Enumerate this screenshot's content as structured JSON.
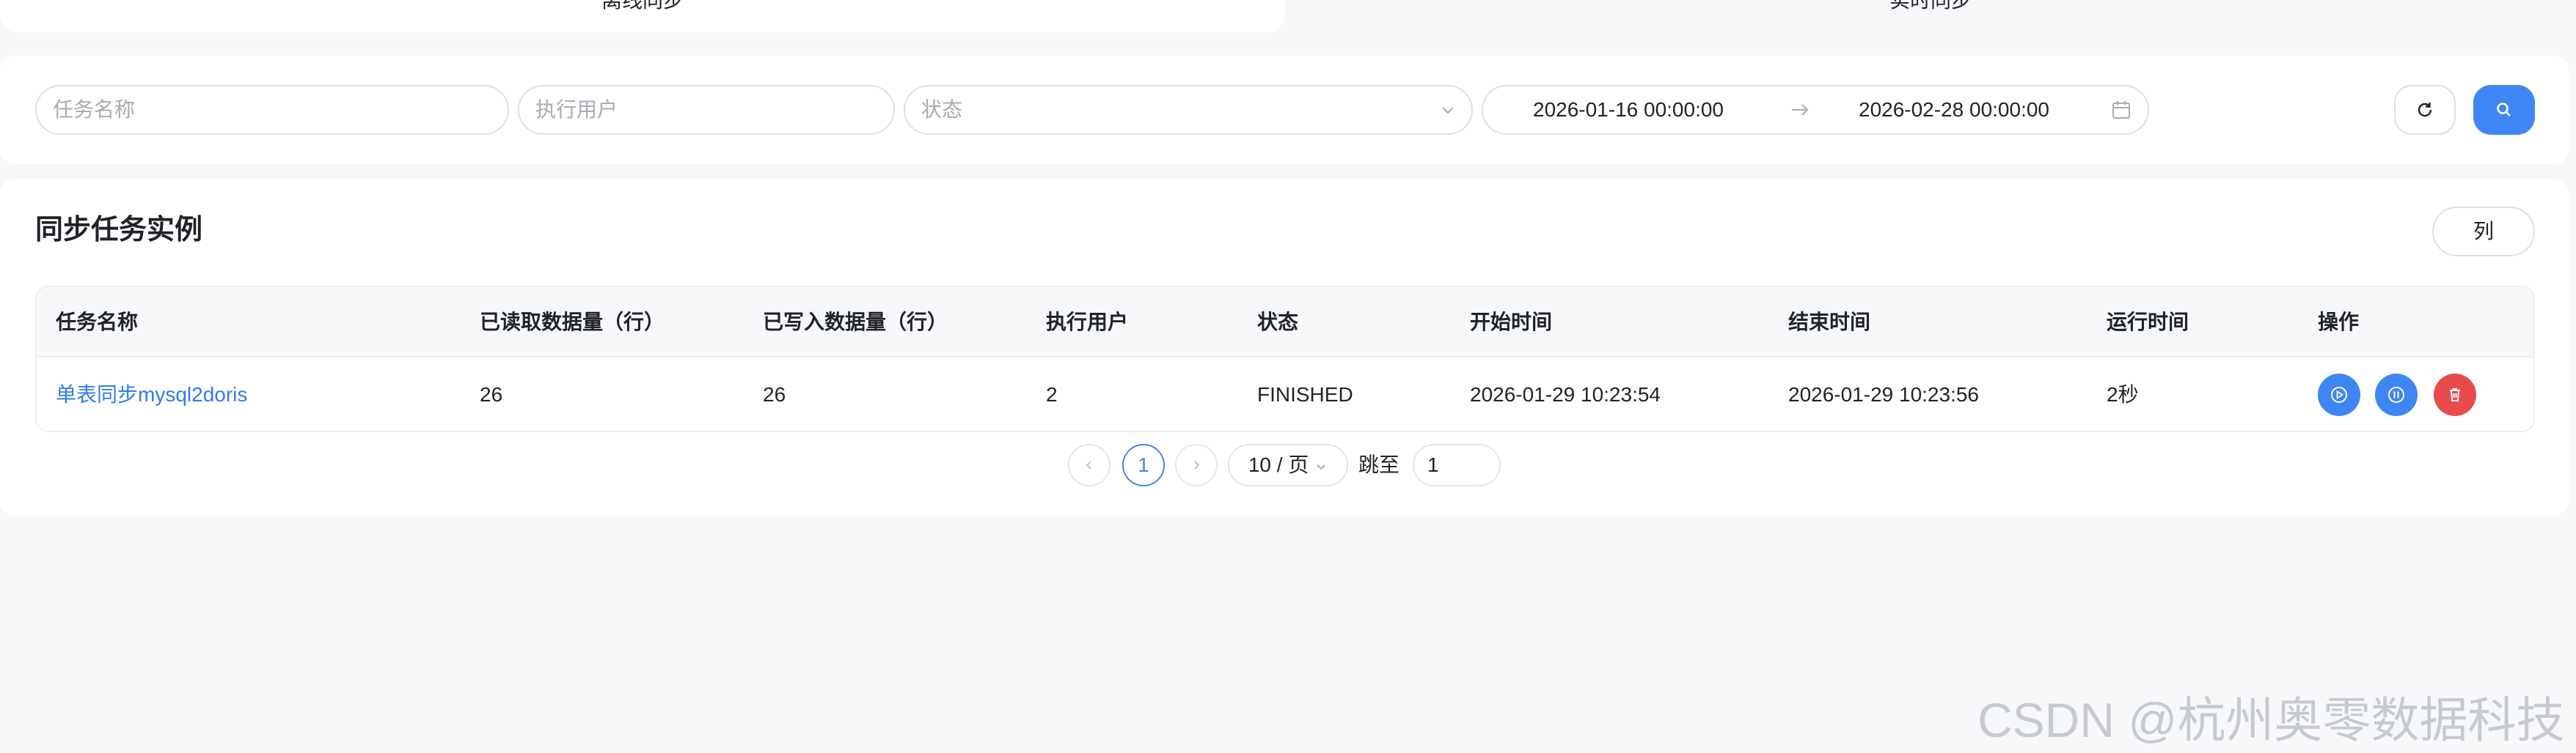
{
  "tabs": [
    {
      "label": "离线同步",
      "active": true
    },
    {
      "label": "实时同步",
      "active": false
    }
  ],
  "filters": {
    "task_name_placeholder": "任务名称",
    "user_placeholder": "执行用户",
    "status_placeholder": "状态",
    "date_start": "2026-01-16 00:00:00",
    "date_end": "2026-02-28 00:00:00"
  },
  "card": {
    "title": "同步任务实例",
    "columns_button": "列"
  },
  "table": {
    "headers": [
      "任务名称",
      "已读取数据量（行）",
      "已写入数据量（行）",
      "执行用户",
      "状态",
      "开始时间",
      "结束时间",
      "运行时间",
      "操作"
    ],
    "rows": [
      {
        "task_name": "单表同步mysql2doris",
        "read_rows": "26",
        "written_rows": "26",
        "user": "2",
        "status": "FINISHED",
        "start_time": "2026-01-29 10:23:54",
        "end_time": "2026-01-29 10:23:56",
        "duration": "2秒"
      }
    ]
  },
  "pagination": {
    "current_page": "1",
    "page_size": "10 / 页",
    "jump_label": "跳至",
    "jump_value": "1"
  },
  "watermark": "CSDN @杭州奥零数据科技",
  "colors": {
    "primary": "#3f86f5",
    "danger": "#e74b4b",
    "link": "#2f7bf0",
    "background": "#f7f8fa"
  }
}
